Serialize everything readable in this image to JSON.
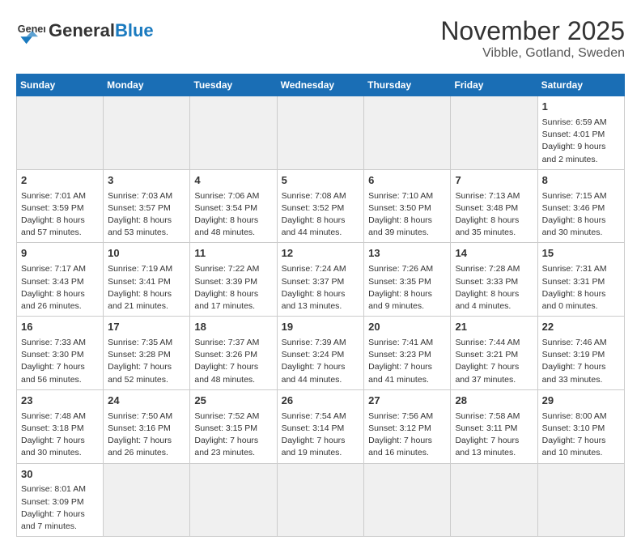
{
  "header": {
    "logo_general": "General",
    "logo_blue": "Blue",
    "title": "November 2025",
    "subtitle": "Vibble, Gotland, Sweden"
  },
  "days_of_week": [
    "Sunday",
    "Monday",
    "Tuesday",
    "Wednesday",
    "Thursday",
    "Friday",
    "Saturday"
  ],
  "weeks": [
    {
      "cells": [
        {
          "day": null,
          "info": null
        },
        {
          "day": null,
          "info": null
        },
        {
          "day": null,
          "info": null
        },
        {
          "day": null,
          "info": null
        },
        {
          "day": null,
          "info": null
        },
        {
          "day": null,
          "info": null
        },
        {
          "day": "1",
          "info": "Sunrise: 6:59 AM\nSunset: 4:01 PM\nDaylight: 9 hours and 2 minutes."
        }
      ]
    },
    {
      "cells": [
        {
          "day": "2",
          "info": "Sunrise: 7:01 AM\nSunset: 3:59 PM\nDaylight: 8 hours and 57 minutes."
        },
        {
          "day": "3",
          "info": "Sunrise: 7:03 AM\nSunset: 3:57 PM\nDaylight: 8 hours and 53 minutes."
        },
        {
          "day": "4",
          "info": "Sunrise: 7:06 AM\nSunset: 3:54 PM\nDaylight: 8 hours and 48 minutes."
        },
        {
          "day": "5",
          "info": "Sunrise: 7:08 AM\nSunset: 3:52 PM\nDaylight: 8 hours and 44 minutes."
        },
        {
          "day": "6",
          "info": "Sunrise: 7:10 AM\nSunset: 3:50 PM\nDaylight: 8 hours and 39 minutes."
        },
        {
          "day": "7",
          "info": "Sunrise: 7:13 AM\nSunset: 3:48 PM\nDaylight: 8 hours and 35 minutes."
        },
        {
          "day": "8",
          "info": "Sunrise: 7:15 AM\nSunset: 3:46 PM\nDaylight: 8 hours and 30 minutes."
        }
      ]
    },
    {
      "cells": [
        {
          "day": "9",
          "info": "Sunrise: 7:17 AM\nSunset: 3:43 PM\nDaylight: 8 hours and 26 minutes."
        },
        {
          "day": "10",
          "info": "Sunrise: 7:19 AM\nSunset: 3:41 PM\nDaylight: 8 hours and 21 minutes."
        },
        {
          "day": "11",
          "info": "Sunrise: 7:22 AM\nSunset: 3:39 PM\nDaylight: 8 hours and 17 minutes."
        },
        {
          "day": "12",
          "info": "Sunrise: 7:24 AM\nSunset: 3:37 PM\nDaylight: 8 hours and 13 minutes."
        },
        {
          "day": "13",
          "info": "Sunrise: 7:26 AM\nSunset: 3:35 PM\nDaylight: 8 hours and 9 minutes."
        },
        {
          "day": "14",
          "info": "Sunrise: 7:28 AM\nSunset: 3:33 PM\nDaylight: 8 hours and 4 minutes."
        },
        {
          "day": "15",
          "info": "Sunrise: 7:31 AM\nSunset: 3:31 PM\nDaylight: 8 hours and 0 minutes."
        }
      ]
    },
    {
      "cells": [
        {
          "day": "16",
          "info": "Sunrise: 7:33 AM\nSunset: 3:30 PM\nDaylight: 7 hours and 56 minutes."
        },
        {
          "day": "17",
          "info": "Sunrise: 7:35 AM\nSunset: 3:28 PM\nDaylight: 7 hours and 52 minutes."
        },
        {
          "day": "18",
          "info": "Sunrise: 7:37 AM\nSunset: 3:26 PM\nDaylight: 7 hours and 48 minutes."
        },
        {
          "day": "19",
          "info": "Sunrise: 7:39 AM\nSunset: 3:24 PM\nDaylight: 7 hours and 44 minutes."
        },
        {
          "day": "20",
          "info": "Sunrise: 7:41 AM\nSunset: 3:23 PM\nDaylight: 7 hours and 41 minutes."
        },
        {
          "day": "21",
          "info": "Sunrise: 7:44 AM\nSunset: 3:21 PM\nDaylight: 7 hours and 37 minutes."
        },
        {
          "day": "22",
          "info": "Sunrise: 7:46 AM\nSunset: 3:19 PM\nDaylight: 7 hours and 33 minutes."
        }
      ]
    },
    {
      "cells": [
        {
          "day": "23",
          "info": "Sunrise: 7:48 AM\nSunset: 3:18 PM\nDaylight: 7 hours and 30 minutes."
        },
        {
          "day": "24",
          "info": "Sunrise: 7:50 AM\nSunset: 3:16 PM\nDaylight: 7 hours and 26 minutes."
        },
        {
          "day": "25",
          "info": "Sunrise: 7:52 AM\nSunset: 3:15 PM\nDaylight: 7 hours and 23 minutes."
        },
        {
          "day": "26",
          "info": "Sunrise: 7:54 AM\nSunset: 3:14 PM\nDaylight: 7 hours and 19 minutes."
        },
        {
          "day": "27",
          "info": "Sunrise: 7:56 AM\nSunset: 3:12 PM\nDaylight: 7 hours and 16 minutes."
        },
        {
          "day": "28",
          "info": "Sunrise: 7:58 AM\nSunset: 3:11 PM\nDaylight: 7 hours and 13 minutes."
        },
        {
          "day": "29",
          "info": "Sunrise: 8:00 AM\nSunset: 3:10 PM\nDaylight: 7 hours and 10 minutes."
        }
      ]
    },
    {
      "cells": [
        {
          "day": "30",
          "info": "Sunrise: 8:01 AM\nSunset: 3:09 PM\nDaylight: 7 hours and 7 minutes."
        },
        {
          "day": null,
          "info": null
        },
        {
          "day": null,
          "info": null
        },
        {
          "day": null,
          "info": null
        },
        {
          "day": null,
          "info": null
        },
        {
          "day": null,
          "info": null
        },
        {
          "day": null,
          "info": null
        }
      ]
    }
  ]
}
